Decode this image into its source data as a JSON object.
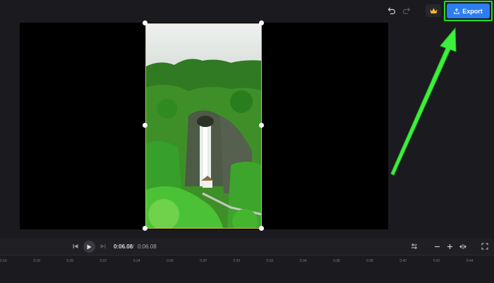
{
  "toolbar": {
    "undo_icon": "undo-icon",
    "redo_icon": "redo-icon",
    "premium_icon": "crown-icon",
    "export_label": "Export",
    "export_icon": "upload-icon",
    "export_color": "#2c7df0",
    "highlight_color": "#1fe01f"
  },
  "preview": {
    "scene": "waterfall-jungle-video"
  },
  "playback": {
    "current_time": "0:06.08",
    "separator": "/",
    "total_time": "0:06.08"
  },
  "timeline": {
    "ticks": [
      "0:16",
      "0:18",
      "0:20",
      "0:22",
      "0:24",
      "0:26",
      "0:28",
      "0:30",
      "0:32",
      "0:34",
      "0:36",
      "0:38",
      "0:40",
      "0:42",
      "0:44"
    ]
  }
}
